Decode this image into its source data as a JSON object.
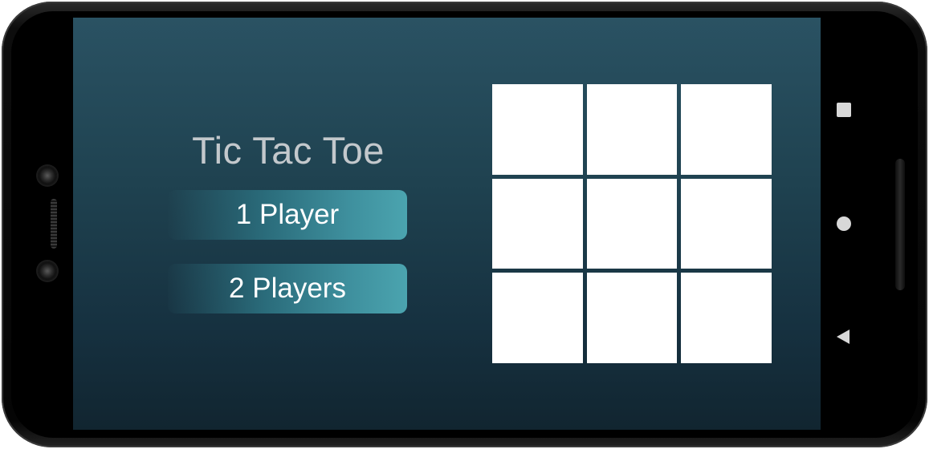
{
  "app": {
    "title": "Tic Tac Toe"
  },
  "menu": {
    "one_player_label": "1 Player",
    "two_players_label": "2 Players"
  },
  "board": {
    "cells": [
      "",
      "",
      "",
      "",
      "",
      "",
      "",
      "",
      ""
    ]
  },
  "nav": {
    "icons": [
      "recent-apps-icon",
      "home-icon",
      "back-icon"
    ]
  },
  "colors": {
    "screen_top": "#2a5263",
    "screen_bottom": "#112530",
    "button_accent": "#4ba4af",
    "title_text": "#c3c8cc",
    "cell_fill": "#ffffff"
  }
}
